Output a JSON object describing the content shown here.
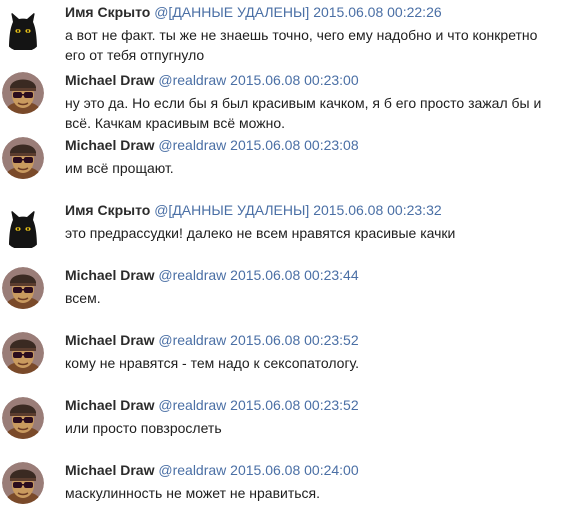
{
  "messages": [
    {
      "author": "Имя Скрыто",
      "handle": "@[ДАННЫЕ УДАЛЕНЫ]",
      "time": "2015.06.08 00:22:26",
      "text": "а вот не факт. ты же не знаешь точно, чего ему надобно и что конкретно его от тебя отпугнуло",
      "avatar": "cat-avatar"
    },
    {
      "author": "Michael Draw",
      "handle": "@realdraw",
      "time": "2015.06.08 00:23:00",
      "text": "ну это да. Но если бы я был красивым качком, я б его просто зажал бы и всё. Качкам красивым всё можно.",
      "avatar": "man-avatar"
    },
    {
      "author": "Michael Draw",
      "handle": "@realdraw",
      "time": "2015.06.08 00:23:08",
      "text": "им всё прощают.",
      "avatar": "man-avatar"
    },
    {
      "author": "Имя Скрыто",
      "handle": "@[ДАННЫЕ УДАЛЕНЫ]",
      "time": "2015.06.08 00:23:32",
      "text": "это предрассудки! далеко не всем нравятся красивые качки",
      "avatar": "cat-avatar"
    },
    {
      "author": "Michael Draw",
      "handle": "@realdraw",
      "time": "2015.06.08 00:23:44",
      "text": "всем.",
      "avatar": "man-avatar"
    },
    {
      "author": "Michael Draw",
      "handle": "@realdraw",
      "time": "2015.06.08 00:23:52",
      "text": "кому не нравятся - тем надо к сексопатологу.",
      "avatar": "man-avatar"
    },
    {
      "author": "Michael Draw",
      "handle": "@realdraw",
      "time": "2015.06.08 00:23:52",
      "text": "или просто повзрослеть",
      "avatar": "man-avatar"
    },
    {
      "author": "Michael Draw",
      "handle": "@realdraw",
      "time": "2015.06.08 00:24:00",
      "text": "маскулинность не может не нравиться.",
      "avatar": "man-avatar"
    }
  ]
}
